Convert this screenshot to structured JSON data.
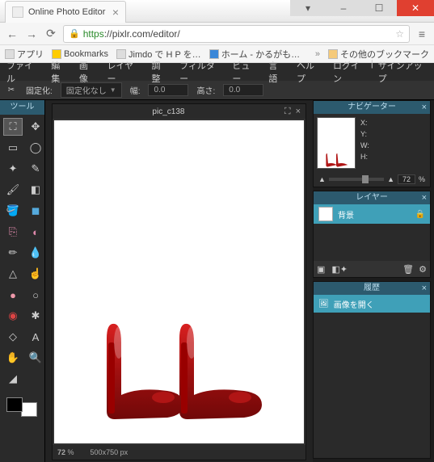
{
  "browser": {
    "tab_title": "Online Photo Editor",
    "url_https": "https",
    "url_rest": "://pixlr.com/editor/",
    "bookmarks": {
      "apps": "アプリ",
      "b1": "Bookmarks",
      "b2": "Jimdo で H P を…",
      "b3": "ホーム - かるがも…",
      "other": "その他のブックマーク"
    }
  },
  "menu": {
    "file": "ファイル",
    "edit": "編集",
    "image": "画像",
    "layer": "レイヤー",
    "adjust": "調整",
    "filter": "フィルター",
    "view": "ビュー",
    "lang": "言語",
    "help": "ヘルプ",
    "login": "ログイン",
    "signup": "サインアップ"
  },
  "options": {
    "fixed_label": "固定化:",
    "fixed_value": "固定化なし",
    "width_label": "幅:",
    "width_value": "0.0",
    "height_label": "高さ:",
    "height_value": "0.0"
  },
  "tools_title": "ツール",
  "canvas": {
    "title": "pic_c138",
    "zoom": "72",
    "pct": "%",
    "dims": "500x750 px"
  },
  "navigator": {
    "title": "ナビゲーター",
    "x": "X:",
    "y": "Y:",
    "w": "W:",
    "h": "H:",
    "zoom": "72",
    "pct": "%"
  },
  "layers": {
    "title": "レイヤー",
    "bg": "背景"
  },
  "history": {
    "title": "履歴",
    "open": "画像を開く"
  }
}
